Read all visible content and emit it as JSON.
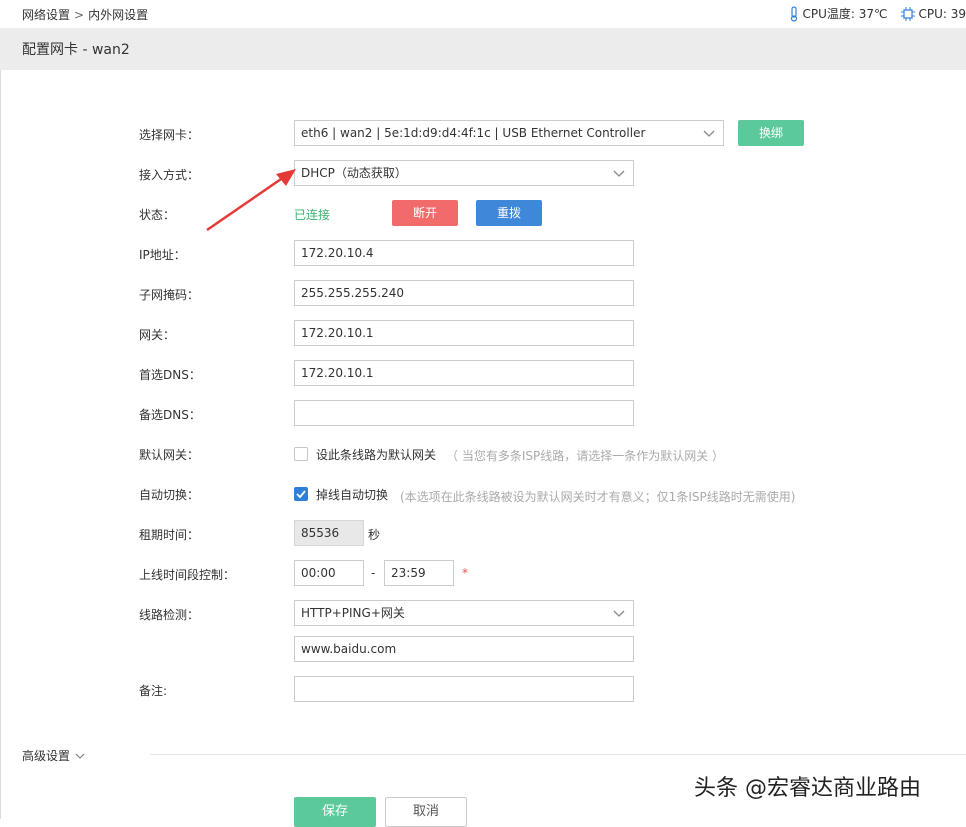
{
  "breadcrumb": {
    "parent": "网络设置",
    "separator": ">",
    "current": "内外网设置"
  },
  "sysinfo": {
    "cpu_temp": "CPU温度: 37℃",
    "cpu_usage": "CPU: 39"
  },
  "page_title": "配置网卡 - wan2",
  "form": {
    "nic": {
      "label": "选择网卡：",
      "value": "eth6 | wan2 | 5e:1d:d9:d4:4f:1c | USB Ethernet Controller",
      "bind_button": "换绑"
    },
    "access_mode": {
      "label": "接入方式：",
      "value": "DHCP（动态获取）"
    },
    "status": {
      "label": "状态：",
      "value": "已连接",
      "disconnect_button": "断开",
      "redial_button": "重拨"
    },
    "ip": {
      "label": "IP地址：",
      "value": "172.20.10.4"
    },
    "netmask": {
      "label": "子网掩码：",
      "value": "255.255.255.240"
    },
    "gateway": {
      "label": "网关：",
      "value": "172.20.10.1"
    },
    "dns1": {
      "label": "首选DNS：",
      "value": "172.20.10.1"
    },
    "dns2": {
      "label": "备选DNS：",
      "value": ""
    },
    "default_gw": {
      "label": "默认网关：",
      "checkbox_label": "设此条线路为默认网关",
      "checked": false,
      "hint": "（ 当您有多条ISP线路，请选择一条作为默认网关 ）"
    },
    "auto_switch": {
      "label": "自动切换：",
      "checkbox_label": "掉线自动切换",
      "checked": true,
      "hint": "(本选项在此条线路被设为默认网关时才有意义；仅1条ISP线路时无需使用)"
    },
    "lease": {
      "label": "租期时间：",
      "value": "85536",
      "unit": "秒"
    },
    "online_time": {
      "label": "上线时间段控制：",
      "start": "00:00",
      "separator": "-",
      "end": "23:59",
      "required_mark": "*"
    },
    "line_check": {
      "label": "线路检测：",
      "value": "HTTP+PING+网关",
      "target": "www.baidu.com"
    },
    "note": {
      "label": "备注:",
      "value": ""
    }
  },
  "advanced": {
    "label": "高级设置"
  },
  "actions": {
    "save": "保存",
    "cancel": "取消"
  },
  "watermark": "头条 @宏睿达商业路由",
  "colors": {
    "primary_green": "#5cc99a",
    "danger_red": "#f26b6b",
    "primary_blue": "#3f87d8",
    "status_green": "#3cb371",
    "annotation_arrow": "#e53935"
  }
}
